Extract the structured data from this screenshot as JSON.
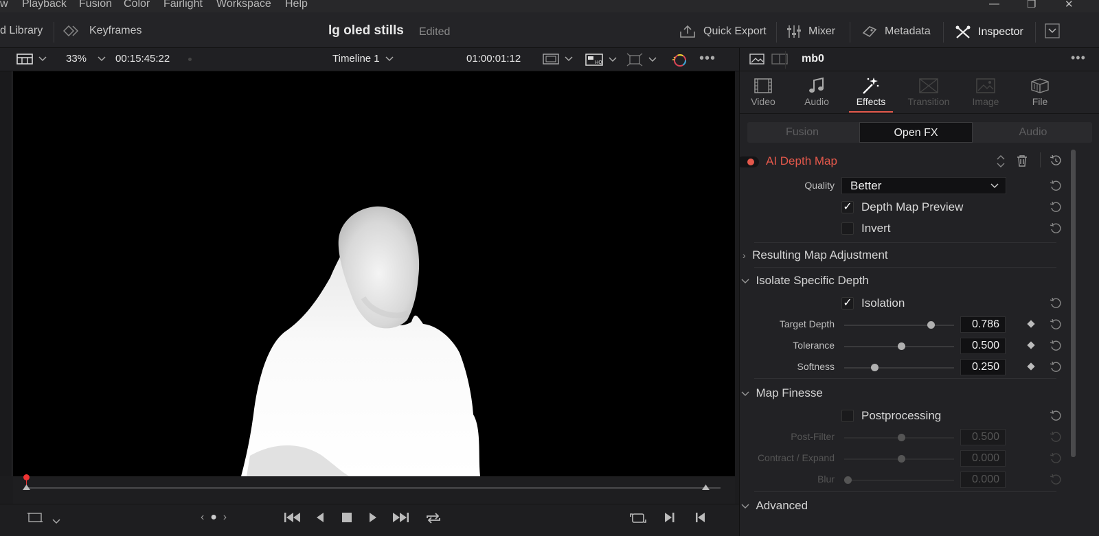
{
  "menu": [
    "w",
    "Playback",
    "Fusion",
    "Color",
    "Fairlight",
    "Workspace",
    "Help"
  ],
  "toolbar": {
    "left_item": "d Library",
    "keyframes": "Keyframes",
    "project_title": "lg oled stills",
    "project_status": "Edited",
    "quick_export": "Quick Export",
    "mixer": "Mixer",
    "metadata": "Metadata",
    "inspector": "Inspector"
  },
  "viewer_bar": {
    "zoom": "33%",
    "source_timecode": "00:15:45:22",
    "timeline_name": "Timeline 1",
    "record_timecode": "01:00:01:12"
  },
  "inspector": {
    "clip_name": "mb0",
    "tabs": [
      {
        "label": "Video",
        "icon": "film-icon",
        "state": "normal"
      },
      {
        "label": "Audio",
        "icon": "music-note-icon",
        "state": "normal"
      },
      {
        "label": "Effects",
        "icon": "magic-wand-icon",
        "state": "active"
      },
      {
        "label": "Transition",
        "icon": "transition-icon",
        "state": "disabled"
      },
      {
        "label": "Image",
        "icon": "image-icon",
        "state": "disabled"
      },
      {
        "label": "File",
        "icon": "file-box-icon",
        "state": "normal"
      }
    ],
    "subtabs": [
      "Fusion",
      "Open FX",
      "Audio"
    ],
    "active_subtab": "Open FX",
    "effect": {
      "name": "AI Depth Map",
      "accent_color": "#e4584b",
      "quality_label": "Quality",
      "quality_value": "Better",
      "depth_map_preview": "Depth Map Preview",
      "depth_map_preview_checked": true,
      "invert": "Invert",
      "invert_checked": false
    },
    "sections": {
      "resulting": "Resulting Map Adjustment",
      "isolate": "Isolate Specific Depth",
      "finesse": "Map Finesse",
      "advanced": "Advanced"
    },
    "isolation": {
      "label": "Isolation",
      "checked": true,
      "params": [
        {
          "label": "Target Depth",
          "value": "0.786",
          "level": 0.78
        },
        {
          "label": "Tolerance",
          "value": "0.500",
          "level": 0.5
        },
        {
          "label": "Softness",
          "value": "0.250",
          "level": 0.25
        }
      ]
    },
    "finesse": {
      "postprocessing": "Postprocessing",
      "checked": false,
      "params": [
        {
          "label": "Post-Filter",
          "value": "0.500",
          "level": 0.5
        },
        {
          "label": "Contract / Expand",
          "value": "0.000",
          "level": 0.5
        },
        {
          "label": "Blur",
          "value": "0.000",
          "level": 0.0
        }
      ]
    }
  }
}
